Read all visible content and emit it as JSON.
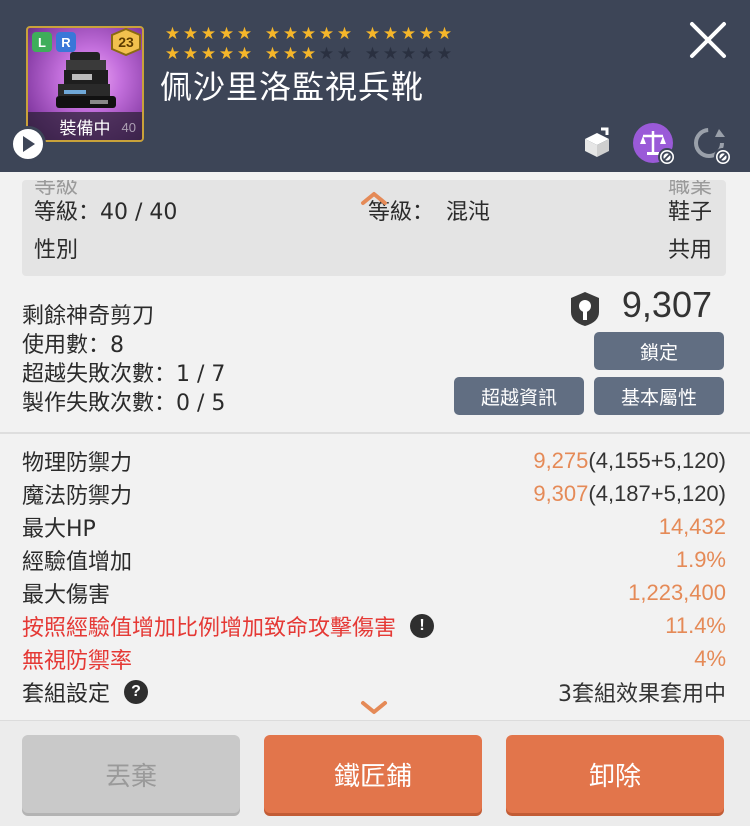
{
  "header": {
    "badge_l": "L",
    "badge_r": "R",
    "item_level_badge": "23",
    "equipped_label": "裝備中",
    "equipped_number": "40",
    "item_name": "佩沙里洛監視兵靴",
    "star_force": {
      "filled": 23,
      "total": 30
    },
    "icons": [
      "enhance-box-icon",
      "scale-icon",
      "refresh-icon"
    ]
  },
  "info": {
    "clipped_left": "等級",
    "clipped_right": "職業",
    "level_label": "等級：40 / 40",
    "level_value_label": "等級：",
    "level_value": "混沌",
    "type": "鞋子",
    "gender_label": "性別",
    "gender_value": "共用"
  },
  "scissors": {
    "remaining_label": "剩餘神奇剪刀",
    "uses": "使用數：8",
    "transcend_fail": "超越失敗次數：1 / 7",
    "craft_fail": "製作失敗次數：0 / 5",
    "power": "9,307",
    "lock_button": "鎖定",
    "transcend_info_button": "超越資訊",
    "base_attr_button": "基本屬性"
  },
  "stats": [
    {
      "label": "物理防禦力",
      "value": "9,275",
      "base": "(4,155+5,120)",
      "style": "normal"
    },
    {
      "label": "魔法防禦力",
      "value": "9,307",
      "base": "(4,187+5,120)",
      "style": "normal"
    },
    {
      "label": "最大HP",
      "value": "14,432",
      "base": "",
      "style": "normal"
    },
    {
      "label": "經驗值增加",
      "value": "1.9%",
      "base": "",
      "style": "normal"
    },
    {
      "label": "最大傷害",
      "value": "1,223,400",
      "base": "",
      "style": "normal"
    },
    {
      "label": "按照經驗值增加比例增加致命攻擊傷害",
      "value": "11.4%",
      "base": "",
      "style": "red",
      "mark": "!"
    },
    {
      "label": "無視防禦率",
      "value": "4%",
      "base": "",
      "style": "red"
    },
    {
      "label": "套組設定",
      "value": "3套組效果套用中",
      "base": "",
      "style": "normal",
      "mark": "?"
    }
  ],
  "footer": {
    "discard": "丟棄",
    "blacksmith": "鐵匠鋪",
    "unequip": "卸除"
  },
  "colors": {
    "header_bg": "#3d4557",
    "accent_orange": "#e2754b",
    "stat_orange": "#e58a57",
    "red": "#e53935",
    "star": "#f5b62a"
  }
}
